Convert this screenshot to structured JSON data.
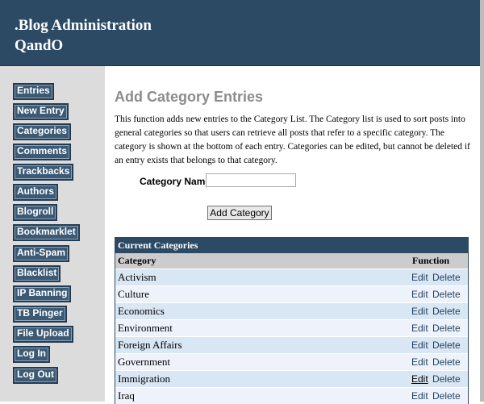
{
  "header": {
    "line1": ".Blog Administration",
    "line2": "QandO"
  },
  "sidebar": {
    "items": [
      {
        "label": "Entries"
      },
      {
        "label": "New Entry"
      },
      {
        "label": "Categories"
      },
      {
        "label": "Comments"
      },
      {
        "label": "Trackbacks"
      },
      {
        "label": "Authors"
      },
      {
        "label": "Blogroll"
      },
      {
        "label": "Bookmarklet"
      },
      {
        "label": "Anti-Spam"
      },
      {
        "label": "Blacklist"
      },
      {
        "label": "IP Banning"
      },
      {
        "label": "TB Pinger"
      },
      {
        "label": "File Upload"
      },
      {
        "label": "Log In"
      },
      {
        "label": "Log Out"
      }
    ]
  },
  "main": {
    "title": "Add Category Entries",
    "description": "This function adds new entries to the Category List. The Category list is used to sort posts into general categories so that users can retrieve all posts that refer to a specific category. The category is shown at the bottom of each entry. Categories can be edited, but cannot be deleted if an entry exists that belongs to that category.",
    "form": {
      "label": "Category Name:",
      "value": "",
      "button": "Add Category"
    },
    "table": {
      "title": "Current Categories",
      "col_category": "Category",
      "col_function": "Function",
      "edit_label": "Edit",
      "delete_label": "Delete",
      "rows": [
        {
          "name": "Activism"
        },
        {
          "name": "Culture"
        },
        {
          "name": "Economics"
        },
        {
          "name": "Environment"
        },
        {
          "name": "Foreign Affairs"
        },
        {
          "name": "Government"
        },
        {
          "name": "Immigration"
        },
        {
          "name": "Iraq"
        }
      ]
    }
  },
  "colors": {
    "header_bg": "#2d4a65",
    "sidebar_bg": "#dcdcdc",
    "nav_btn_bg": "#3d5a75",
    "row_odd": "#d9e6f3",
    "row_even": "#eef3fb"
  }
}
